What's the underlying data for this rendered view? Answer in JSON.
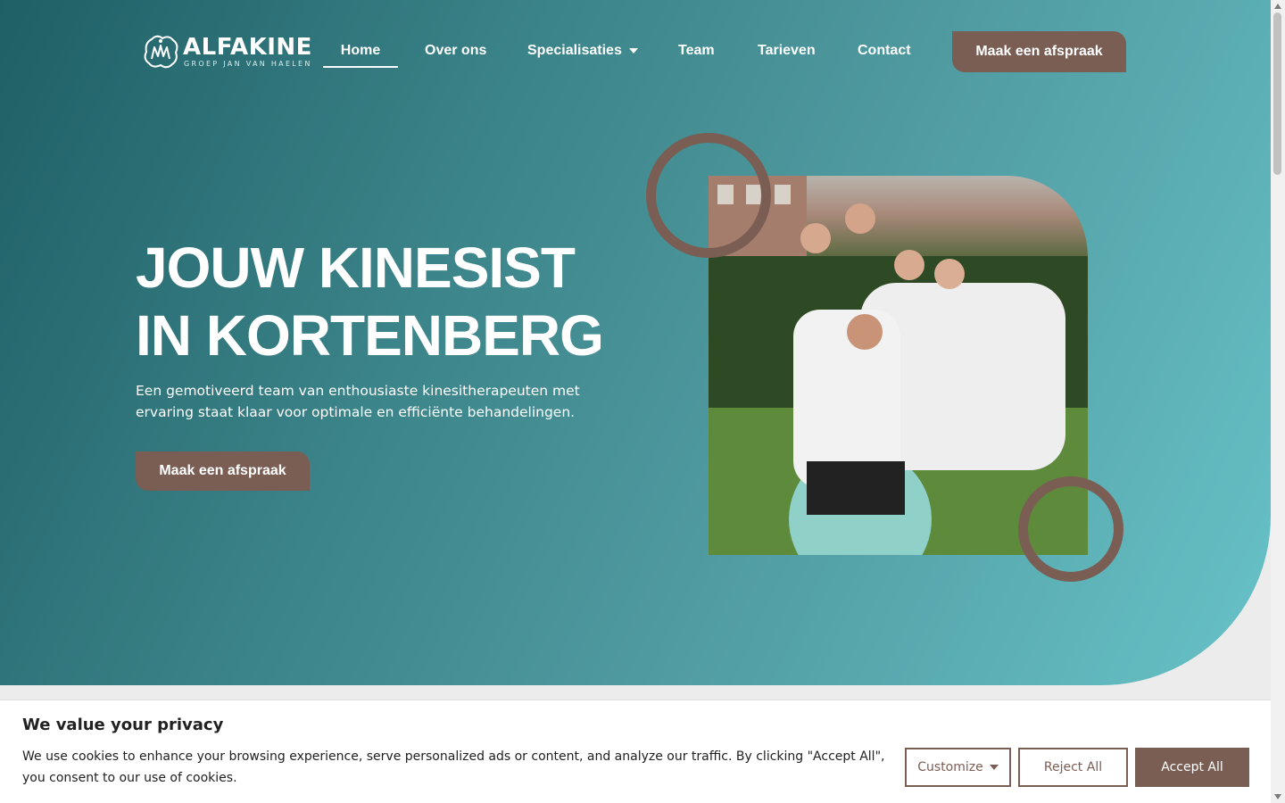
{
  "brand": {
    "name": "ALFAKINE",
    "tagline": "GROEP JAN VAN HAELEN",
    "icon": "logo-mark"
  },
  "nav": {
    "items": [
      {
        "label": "Home",
        "active": true
      },
      {
        "label": "Over ons"
      },
      {
        "label": "Specialisaties",
        "has_dropdown": true
      },
      {
        "label": "Team"
      },
      {
        "label": "Tarieven"
      },
      {
        "label": "Contact"
      }
    ],
    "cta_label": "Maak een afspraak"
  },
  "hero": {
    "title_line1": "JOUW KINESIST",
    "title_line2": "IN KORTENBERG",
    "subtitle": "Een gemotiveerd team van enthousiaste kinesitherapeuten met ervaring staat klaar voor optimale en efficiënte behandelingen.",
    "cta_label": "Maak een afspraak"
  },
  "cookie_banner": {
    "title": "We value your privacy",
    "text": "We use cookies to enhance your browsing experience, serve personalized ads or content, and analyze our traffic. By clicking \"Accept All\", you consent to our use of cookies.",
    "customize_label": "Customize",
    "reject_label": "Reject All",
    "accept_label": "Accept All"
  },
  "colors": {
    "accent_brown": "#7a5e54",
    "teal_dark": "#1f5f66",
    "teal_light": "#67c2c7"
  }
}
